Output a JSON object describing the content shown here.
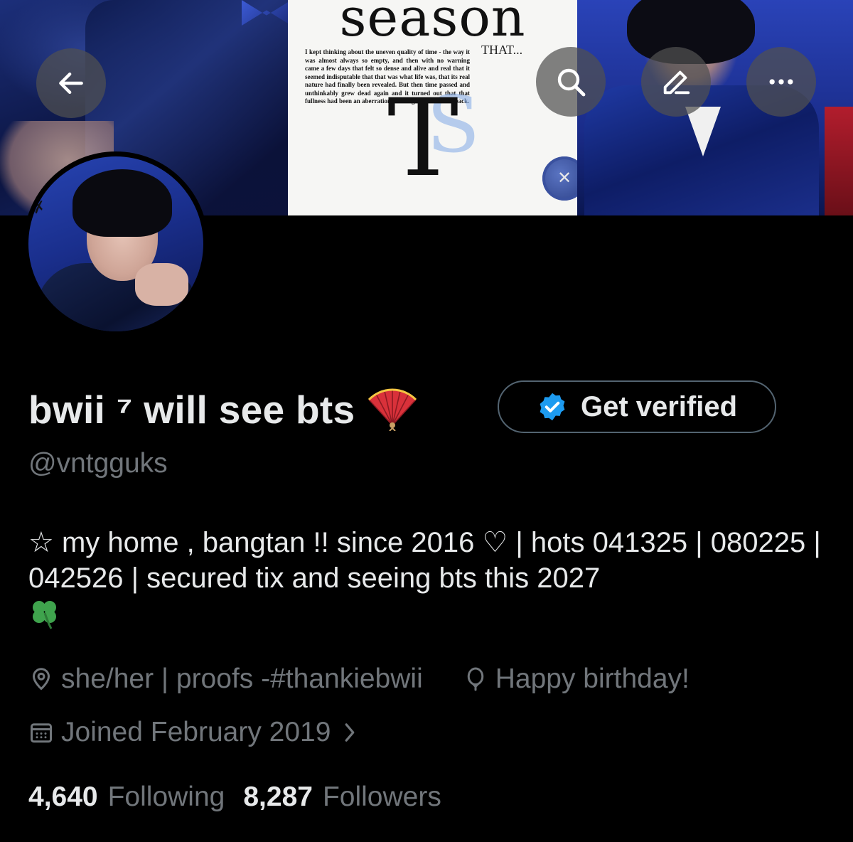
{
  "profile": {
    "display_name": "bwii ⁷ will see bts",
    "handle": "@vntgguks",
    "bio": "☆ my home , bangtan !! since 2016 ♡ | hots 041325 | 080225 | 042526 | secured tix and seeing bts this 2027",
    "location": "she/her | proofs -#thankiebwii",
    "birthday": "Happy birthday!",
    "joined": "Joined February 2019",
    "following_count": "4,640",
    "following_label": "Following",
    "followers_count": "8,287",
    "followers_label": "Followers"
  },
  "actions": {
    "verify_label": "Get verified"
  },
  "banner": {
    "headline": "season",
    "subline": "THAT...",
    "poem": "I kept thinking about the uneven quality of time - the way it was almost always so empty, and then with no warning came a few days that felt so dense and alive and real that it seemed indisputable that that was what life was, that its real nature had finally been revealed. But then time passed and unthinkably grew dead again and it turned out that that fullness had been an aberration and might never come back."
  },
  "icons": {
    "back": "arrow-left-icon",
    "search": "search-icon",
    "edit": "edit-pencil-icon",
    "more": "more-dots-icon",
    "verified": "verified-badge-icon",
    "location": "location-pin-icon",
    "birthday": "balloon-icon",
    "calendar": "calendar-icon",
    "chevron": "chevron-right-icon",
    "fan": "folding-fan-icon",
    "clover": "four-leaf-clover-icon"
  },
  "colors": {
    "background": "#000000",
    "primary_text": "#e7e9ea",
    "secondary_text": "#71767b",
    "verified_blue": "#1d9bf0",
    "button_border": "#536471"
  }
}
